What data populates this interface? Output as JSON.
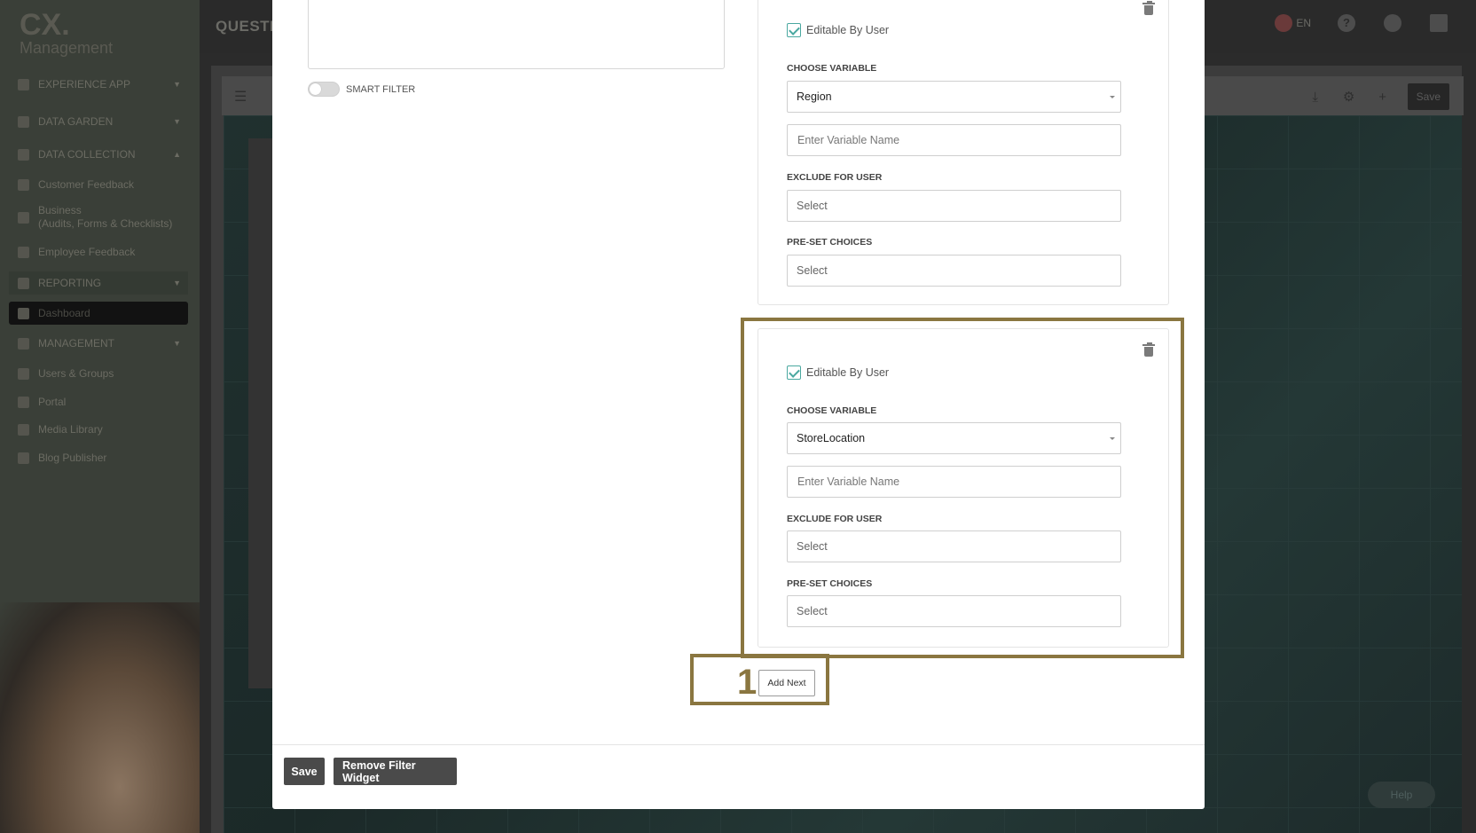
{
  "app": {
    "logo_main": "CX.",
    "logo_sub": "Management",
    "page_title": "QUESTIC",
    "language": "EN"
  },
  "sidebar": {
    "items": [
      {
        "label": "EXPERIENCE APP",
        "icon": "phone-icon"
      },
      {
        "label": "DATA GARDEN",
        "icon": "flask-icon"
      },
      {
        "label": "DATA COLLECTION",
        "icon": "collection-icon"
      },
      {
        "label": "Customer Feedback",
        "icon": "chat-icon"
      },
      {
        "label": "Business\n(Audits, Forms & Checklists)",
        "icon": "briefcase-icon"
      },
      {
        "label": "Employee Feedback",
        "icon": "user-icon"
      },
      {
        "label": "REPORTING",
        "icon": "chart-icon"
      },
      {
        "label": "Dashboard",
        "icon": "dashboard-icon"
      },
      {
        "label": "MANAGEMENT",
        "icon": "person-icon"
      },
      {
        "label": "Users & Groups",
        "icon": "users-icon"
      },
      {
        "label": "Portal",
        "icon": "monitor-icon"
      },
      {
        "label": "Media Library",
        "icon": "image-icon"
      },
      {
        "label": "Blog Publisher",
        "icon": "pen-icon"
      }
    ]
  },
  "background_toolbar": {
    "save_label": "Save",
    "help_label": "Help"
  },
  "modal": {
    "smart_filter_label": "SMART FILTER",
    "filter_cards": [
      {
        "editable_label": "Editable By User",
        "choose_variable_label": "CHOOSE VARIABLE",
        "choose_variable_value": "Region",
        "variable_name_placeholder": "Enter Variable Name",
        "exclude_label": "EXCLUDE FOR USER",
        "exclude_value": "Select",
        "preset_label": "PRE-SET CHOICES",
        "preset_value": "Select"
      },
      {
        "editable_label": "Editable By User",
        "choose_variable_label": "CHOOSE VARIABLE",
        "choose_variable_value": "StoreLocation",
        "variable_name_placeholder": "Enter Variable Name",
        "exclude_label": "EXCLUDE FOR USER",
        "exclude_value": "Select",
        "preset_label": "PRE-SET CHOICES",
        "preset_value": "Select"
      }
    ],
    "step_number": "1",
    "add_next_label": "Add Next",
    "save_label": "Save",
    "remove_label": "Remove Filter Widget"
  },
  "colors": {
    "highlight": "#8a7640",
    "checkbox": "#4aa8a0",
    "dark_button": "#4a4a4a"
  }
}
